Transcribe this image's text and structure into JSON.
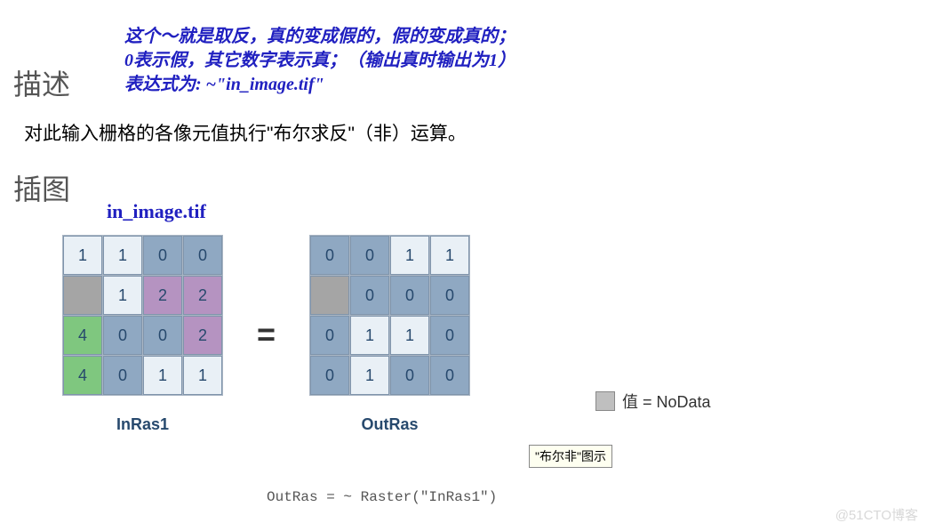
{
  "annotation": {
    "line1": "这个～就是取反，真的变成假的，假的变成真的；",
    "line2": "0表示假，其它数字表示真；（输出真时输出为1）",
    "line3": "表达式为: ~\"in_image.tif\""
  },
  "headings": {
    "description": "描述",
    "illustration": "插图"
  },
  "description_text": "对此输入栅格的各像元值执行\"布尔求反\"（非）运算。",
  "in_image_label": "in_image.tif",
  "equals": "=",
  "grids": {
    "in": {
      "label": "InRas1",
      "cells": [
        [
          {
            "v": "1",
            "c": "c-light"
          },
          {
            "v": "1",
            "c": "c-light"
          },
          {
            "v": "0",
            "c": "c-blue"
          },
          {
            "v": "0",
            "c": "c-blue"
          }
        ],
        [
          {
            "v": "",
            "c": "c-gray"
          },
          {
            "v": "1",
            "c": "c-light"
          },
          {
            "v": "2",
            "c": "c-purple"
          },
          {
            "v": "2",
            "c": "c-purple"
          }
        ],
        [
          {
            "v": "4",
            "c": "c-green"
          },
          {
            "v": "0",
            "c": "c-blue"
          },
          {
            "v": "0",
            "c": "c-blue"
          },
          {
            "v": "2",
            "c": "c-purple"
          }
        ],
        [
          {
            "v": "4",
            "c": "c-green"
          },
          {
            "v": "0",
            "c": "c-blue"
          },
          {
            "v": "1",
            "c": "c-light"
          },
          {
            "v": "1",
            "c": "c-light"
          }
        ]
      ]
    },
    "out": {
      "label": "OutRas",
      "cells": [
        [
          {
            "v": "0",
            "c": "c-blue"
          },
          {
            "v": "0",
            "c": "c-blue"
          },
          {
            "v": "1",
            "c": "c-light"
          },
          {
            "v": "1",
            "c": "c-light"
          }
        ],
        [
          {
            "v": "",
            "c": "c-gray"
          },
          {
            "v": "0",
            "c": "c-blue"
          },
          {
            "v": "0",
            "c": "c-blue"
          },
          {
            "v": "0",
            "c": "c-blue"
          }
        ],
        [
          {
            "v": "0",
            "c": "c-blue"
          },
          {
            "v": "1",
            "c": "c-light"
          },
          {
            "v": "1",
            "c": "c-light"
          },
          {
            "v": "0",
            "c": "c-blue"
          }
        ],
        [
          {
            "v": "0",
            "c": "c-blue"
          },
          {
            "v": "1",
            "c": "c-light"
          },
          {
            "v": "0",
            "c": "c-blue"
          },
          {
            "v": "0",
            "c": "c-blue"
          }
        ]
      ]
    }
  },
  "legend_text": "值 = NoData",
  "tooltip": "\"布尔非\"图示",
  "code_line": "OutRas = ~ Raster(\"InRas1\")",
  "watermark": "@51CTO博客"
}
